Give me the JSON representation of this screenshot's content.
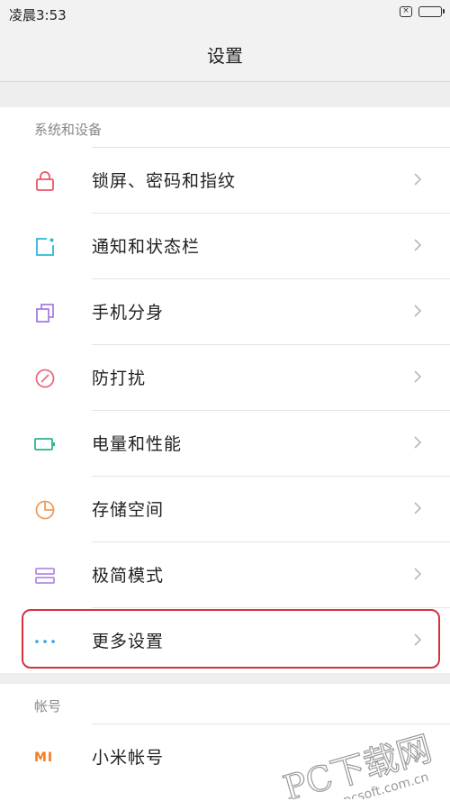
{
  "status_bar": {
    "time": "凌晨3:53",
    "notification_glyph": "×"
  },
  "header": {
    "title": "设置"
  },
  "sections": [
    {
      "title": "系统和设备",
      "items": [
        {
          "label": "锁屏、密码和指纹",
          "icon": "lock-icon",
          "icon_color": "#e9556a"
        },
        {
          "label": "通知和状态栏",
          "icon": "notification-icon",
          "icon_color": "#2fb6d6"
        },
        {
          "label": "手机分身",
          "icon": "clone-icon",
          "icon_color": "#a47fe0"
        },
        {
          "label": "防打扰",
          "icon": "do-not-disturb-icon",
          "icon_color": "#ea6a7e"
        },
        {
          "label": "电量和性能",
          "icon": "battery-icon",
          "icon_color": "#25b58f"
        },
        {
          "label": "存储空间",
          "icon": "storage-pie-icon",
          "icon_color": "#f19b5a"
        },
        {
          "label": "极简模式",
          "icon": "minimal-mode-icon",
          "icon_color": "#b58be8"
        },
        {
          "label": "更多设置",
          "icon": "more-dots-icon",
          "icon_color": "#2aa4e6"
        }
      ]
    },
    {
      "title": "帐号",
      "items": [
        {
          "label": "小米帐号",
          "icon": "mi-logo-icon",
          "icon_color": "#f47b20",
          "icon_text": "MI"
        }
      ]
    }
  ],
  "watermark": {
    "text": "PC下载网",
    "url": "www.pcsoft.com.cn",
    "color": "#9a9a9a"
  },
  "colors": {
    "highlight": "#d6323e",
    "chevron": "#b8b8b8"
  }
}
